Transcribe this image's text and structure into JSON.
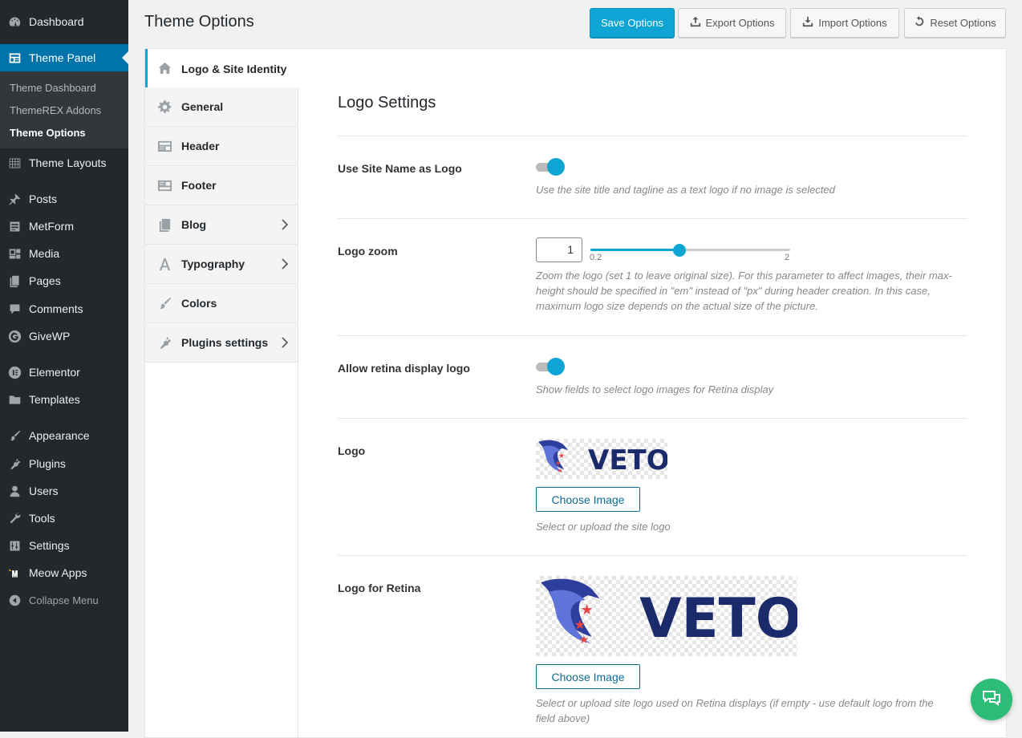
{
  "admin_menu": {
    "items": [
      {
        "label": "Dashboard",
        "icon": "dashboard-icon"
      },
      {
        "label": "Theme Panel",
        "icon": "theme-panel-icon"
      },
      {
        "label": "Theme Layouts",
        "icon": "layouts-icon"
      },
      {
        "label": "Posts",
        "icon": "pin-icon"
      },
      {
        "label": "MetForm",
        "icon": "form-icon"
      },
      {
        "label": "Media",
        "icon": "media-icon"
      },
      {
        "label": "Pages",
        "icon": "pages-icon"
      },
      {
        "label": "Comments",
        "icon": "comments-icon"
      },
      {
        "label": "GiveWP",
        "icon": "give-icon"
      },
      {
        "label": "Elementor",
        "icon": "elementor-icon"
      },
      {
        "label": "Templates",
        "icon": "folder-icon"
      },
      {
        "label": "Appearance",
        "icon": "brush-icon"
      },
      {
        "label": "Plugins",
        "icon": "plugin-icon"
      },
      {
        "label": "Users",
        "icon": "user-icon"
      },
      {
        "label": "Tools",
        "icon": "wrench-icon"
      },
      {
        "label": "Settings",
        "icon": "sliders-icon"
      },
      {
        "label": "Meow Apps",
        "icon": "meow-icon"
      },
      {
        "label": "Collapse Menu",
        "icon": "collapse-icon"
      }
    ],
    "submenu": [
      "Theme Dashboard",
      "ThemeREX Addons",
      "Theme Options"
    ]
  },
  "header": {
    "title": "Theme Options",
    "buttons": {
      "save": "Save Options",
      "export": "Export Options",
      "import": "Import Options",
      "reset": "Reset Options"
    }
  },
  "tabs": [
    {
      "label": "Logo & Site Identity",
      "icon": "home-icon",
      "has_children": false,
      "active": true
    },
    {
      "label": "General",
      "icon": "gear-icon",
      "has_children": false
    },
    {
      "label": "Header",
      "icon": "header-layout-icon",
      "has_children": false
    },
    {
      "label": "Footer",
      "icon": "footer-layout-icon",
      "has_children": false
    },
    {
      "label": "Blog",
      "icon": "blog-icon",
      "has_children": true
    },
    {
      "label": "Typography",
      "icon": "typography-icon",
      "has_children": true
    },
    {
      "label": "Colors",
      "icon": "brush-icon",
      "has_children": false
    },
    {
      "label": "Plugins settings",
      "icon": "plugin-icon",
      "has_children": true
    }
  ],
  "section": {
    "title": "Logo Settings",
    "fields": {
      "site_name_logo": {
        "label": "Use Site Name as Logo",
        "enabled": true,
        "desc": "Use the site title and tagline as a text logo if no image is selected"
      },
      "logo_zoom": {
        "label": "Logo zoom",
        "value": "1",
        "min": 0.2,
        "max": 2,
        "min_label": "0.2",
        "max_label": "2",
        "desc": "Zoom the logo (set 1 to leave original size). For this parameter to affect images, their max-height should be specified in \"em\" instead of \"px\" during header creation. In this case, maximum logo size depends on the actual size of the picture."
      },
      "retina": {
        "label": "Allow retina display logo",
        "enabled": true,
        "desc": "Show fields to select logo images for Retina display"
      },
      "logo": {
        "label": "Logo",
        "image_text": "VETO",
        "button": "Choose Image",
        "desc": "Select or upload the site logo"
      },
      "logo_retina": {
        "label": "Logo for Retina",
        "image_text": "VETO",
        "button": "Choose Image",
        "desc": "Select or upload site logo used on Retina displays (if empty - use default logo from the field above)"
      }
    }
  },
  "colors": {
    "accent": "#0ea5d5",
    "admin_bg": "#23282d",
    "logo_blue": "#1b2a6b",
    "logo_red": "#e94747",
    "chat": "#2ebd77"
  },
  "chat_icon": "chat-bubbles-icon"
}
